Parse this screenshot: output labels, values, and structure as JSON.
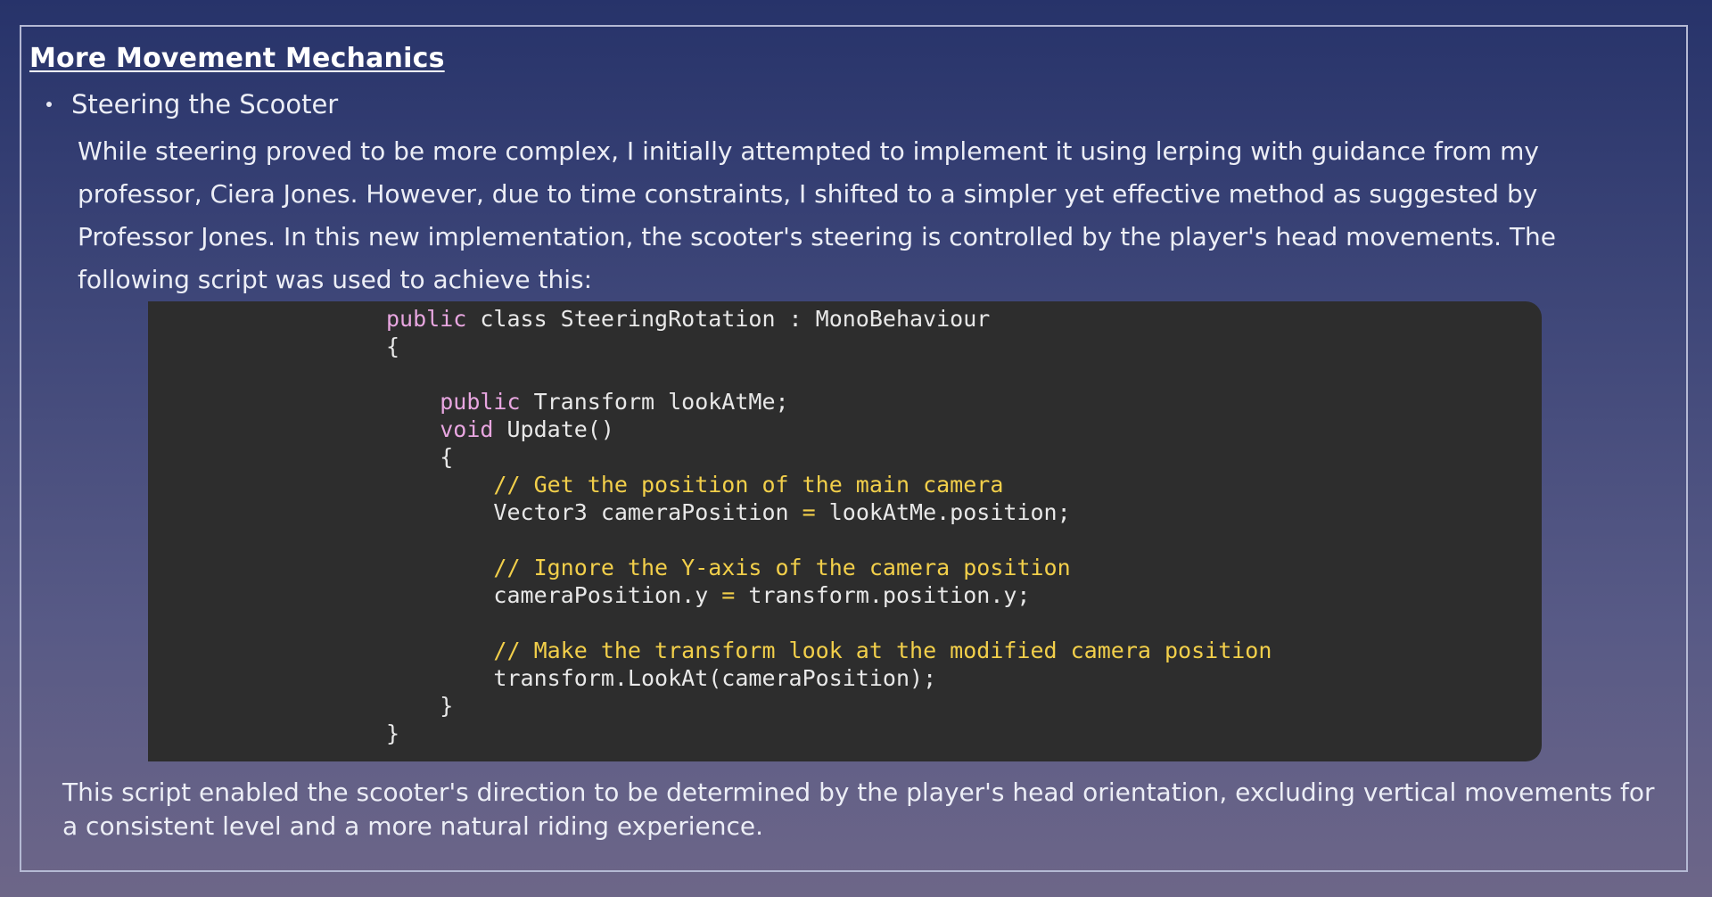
{
  "section": {
    "heading": "More Movement Mechanics",
    "bullet": "Steering the Scooter",
    "intro": "While steering proved to be more complex, I initially attempted to implement it using lerping with guidance from my professor, Ciera Jones. However, due to time constraints, I shifted to a simpler yet effective method as suggested by Professor Jones. In this new implementation, the scooter's steering is controlled by the player's head movements. The following script was used to achieve this:",
    "outro": "This script enabled the scooter's direction to be determined by the player's head orientation, excluding vertical movements for a consistent level and a more natural riding experience."
  },
  "code": {
    "language": "csharp",
    "lines": [
      {
        "indent": "",
        "parts": [
          {
            "t": "public",
            "c": "kw"
          },
          {
            "t": " class SteeringRotation : MonoBehaviour",
            "c": ""
          }
        ]
      },
      {
        "indent": "",
        "parts": [
          {
            "t": "{",
            "c": ""
          }
        ]
      },
      {
        "indent": "",
        "parts": []
      },
      {
        "indent": "    ",
        "parts": [
          {
            "t": "public",
            "c": "kw"
          },
          {
            "t": " Transform lookAtMe;",
            "c": ""
          }
        ]
      },
      {
        "indent": "    ",
        "parts": [
          {
            "t": "void",
            "c": "kw"
          },
          {
            "t": " Update()",
            "c": ""
          }
        ]
      },
      {
        "indent": "    ",
        "parts": [
          {
            "t": "{",
            "c": ""
          }
        ]
      },
      {
        "indent": "        ",
        "parts": [
          {
            "t": "// Get the position of the main camera",
            "c": "cm"
          }
        ]
      },
      {
        "indent": "        ",
        "parts": [
          {
            "t": "Vector3 cameraPosition ",
            "c": ""
          },
          {
            "t": "=",
            "c": "op"
          },
          {
            "t": " lookAtMe.position;",
            "c": ""
          }
        ]
      },
      {
        "indent": "",
        "parts": []
      },
      {
        "indent": "        ",
        "parts": [
          {
            "t": "// Ignore the Y-axis of the camera position",
            "c": "cm"
          }
        ]
      },
      {
        "indent": "        ",
        "parts": [
          {
            "t": "cameraPosition.y ",
            "c": ""
          },
          {
            "t": "=",
            "c": "op"
          },
          {
            "t": " transform.position.y;",
            "c": ""
          }
        ]
      },
      {
        "indent": "",
        "parts": []
      },
      {
        "indent": "        ",
        "parts": [
          {
            "t": "// Make the transform look at the modified camera position",
            "c": "cm"
          }
        ]
      },
      {
        "indent": "        ",
        "parts": [
          {
            "t": "transform.LookAt(cameraPosition);",
            "c": ""
          }
        ]
      },
      {
        "indent": "    ",
        "parts": [
          {
            "t": "}",
            "c": ""
          }
        ]
      },
      {
        "indent": "",
        "parts": [
          {
            "t": "}",
            "c": ""
          }
        ]
      }
    ]
  },
  "colors": {
    "background_top": "#27336a",
    "background_bottom": "#6d6688",
    "code_background": "#2d2d2d",
    "keyword": "#e8a6e0",
    "comment": "#f2cf4a"
  }
}
